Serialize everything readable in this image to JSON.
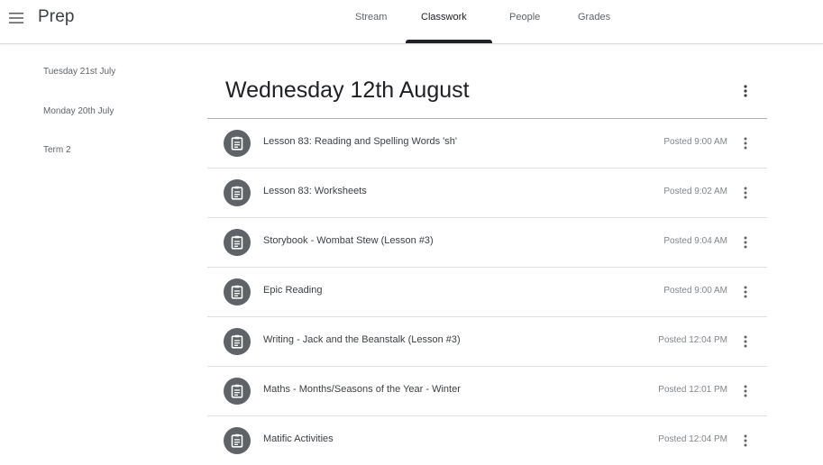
{
  "header": {
    "class_name": "Prep",
    "tabs": [
      {
        "label": "Stream",
        "active": false
      },
      {
        "label": "Classwork",
        "active": true
      },
      {
        "label": "People",
        "active": false
      },
      {
        "label": "Grades",
        "active": false
      }
    ],
    "menu_icon": "hamburger-menu-icon"
  },
  "sidebar": {
    "topics": [
      {
        "label": "Tuesday 21st July"
      },
      {
        "label": "Monday 20th July"
      },
      {
        "label": "Term 2"
      }
    ]
  },
  "main": {
    "topic_title": "Wednesday 12th August",
    "more_icon": "more-vert-icon",
    "assignments": [
      {
        "title": "Lesson 83: Reading and Spelling Words 'sh'",
        "posted": "Posted 9:00 AM",
        "icon": "assignment-icon"
      },
      {
        "title": "Lesson 83: Worksheets",
        "posted": "Posted 9:02 AM",
        "icon": "assignment-icon"
      },
      {
        "title": "Storybook - Wombat Stew (Lesson #3)",
        "posted": "Posted 9:04 AM",
        "icon": "assignment-icon"
      },
      {
        "title": "Epic Reading",
        "posted": "Posted 9:00 AM",
        "icon": "assignment-icon"
      },
      {
        "title": "Writing - Jack and the Beanstalk (Lesson #3)",
        "posted": "Posted 12:04 PM",
        "icon": "assignment-icon"
      },
      {
        "title": "Maths - Months/Seasons of the Year - Winter",
        "posted": "Posted 12:01 PM",
        "icon": "assignment-icon"
      },
      {
        "title": "Matific Activities",
        "posted": "Posted 12:04 PM",
        "icon": "assignment-icon"
      }
    ]
  },
  "colors": {
    "icon_circle": "#5f6368",
    "text_primary": "#202124",
    "text_secondary": "#80868b",
    "active_tab_indicator": "#202124",
    "divider": "#e0e0e0"
  }
}
